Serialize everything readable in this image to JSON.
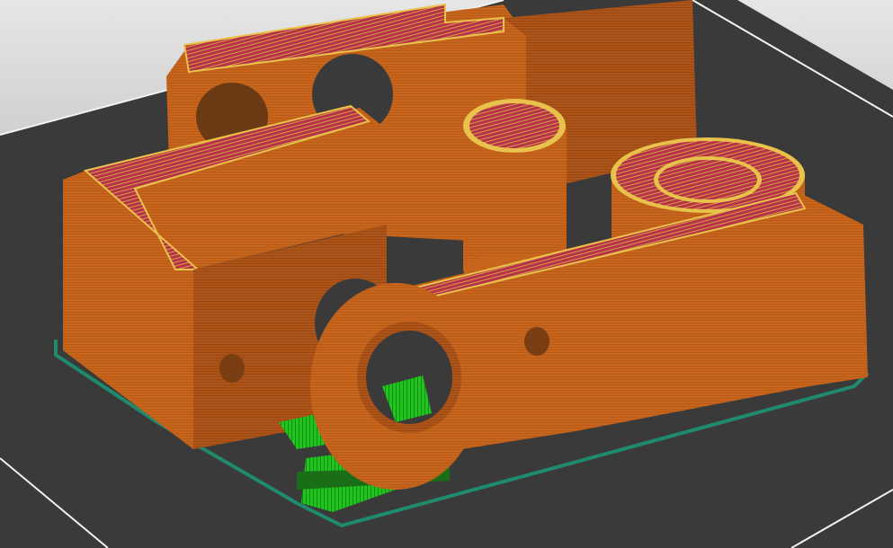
{
  "viewport": {
    "kind": "3d-print-slicer-preview",
    "colors": {
      "background_top": "#e8e8e8",
      "background_bottom": "#9a9a9a",
      "bed": "#3a3a3a",
      "bed_edge": "#ffffff",
      "part_orange": "#c8651c",
      "part_orange_dark": "#a9521a",
      "part_orange_light": "#d7772b",
      "infill_red": "#b8304a",
      "perimeter_yellow": "#e8c24a",
      "support_green": "#22c41f",
      "skirt_teal": "#1f8a6d"
    },
    "objects": [
      "back-bracket",
      "left-block",
      "threaded-cylinder",
      "ring-boss",
      "front-bracket",
      "eyelet-ring",
      "support-material",
      "skirt-outline"
    ]
  }
}
